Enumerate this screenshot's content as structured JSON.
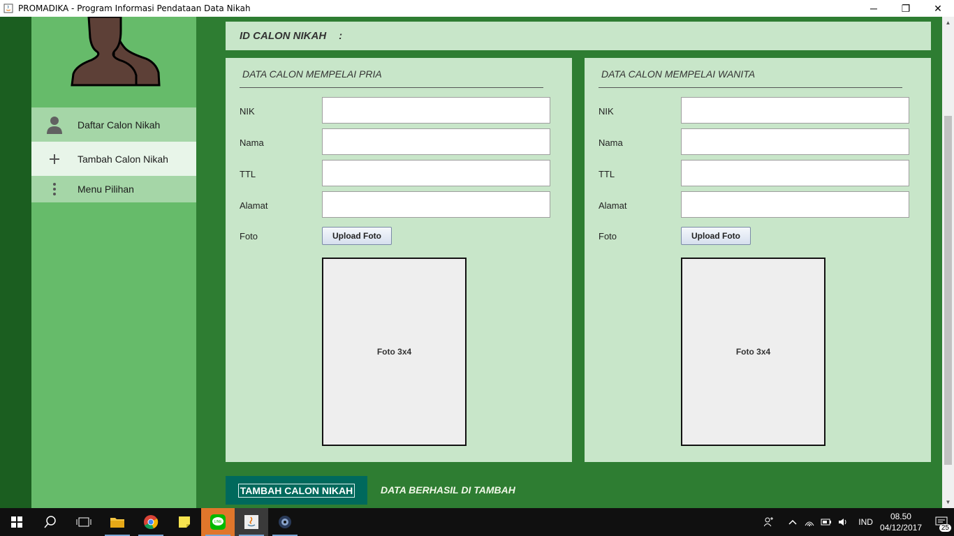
{
  "window": {
    "title": "PROMADIKA - Program Informasi Pendataan Data Nikah",
    "minimize": "─",
    "restore": "❐",
    "close": "✕"
  },
  "sidebar": {
    "items": [
      {
        "label": "Daftar Calon Nikah",
        "icon": "person-icon"
      },
      {
        "label": "Tambah Calon Nikah",
        "icon": "plus-icon"
      },
      {
        "label": "Menu Pilihan",
        "icon": "more-vertical-icon"
      }
    ]
  },
  "header": {
    "id_label": "ID CALON NIKAH",
    "colon": ":"
  },
  "pria": {
    "title": "DATA CALON MEMPELAI PRIA",
    "labels": {
      "nik": "NIK",
      "nama": "Nama",
      "ttl": "TTL",
      "alamat": "Alamat",
      "foto": "Foto"
    },
    "values": {
      "nik": "",
      "nama": "",
      "ttl": "",
      "alamat": ""
    },
    "upload_label": "Upload Foto",
    "photo_placeholder": "Foto 3x4"
  },
  "wanita": {
    "title": "DATA CALON MEMPELAI WANITA",
    "labels": {
      "nik": "NIK",
      "nama": "Nama",
      "ttl": "TTL",
      "alamat": "Alamat",
      "foto": "Foto"
    },
    "values": {
      "nik": "",
      "nama": "",
      "ttl": "",
      "alamat": ""
    },
    "upload_label": "Upload Foto",
    "photo_placeholder": "Foto 3x4"
  },
  "footer": {
    "submit_label": "TAMBAH CALON NIKAH",
    "status": "DATA BERHASIL DI TAMBAH"
  },
  "taskbar": {
    "language": "IND",
    "time": "08.50",
    "date": "04/12/2017",
    "notification_count": "25"
  },
  "colors": {
    "app_bg": "#2e7d32",
    "sidebar": "#66bb6a",
    "panel": "#c8e6c9",
    "submit": "#00695c"
  }
}
